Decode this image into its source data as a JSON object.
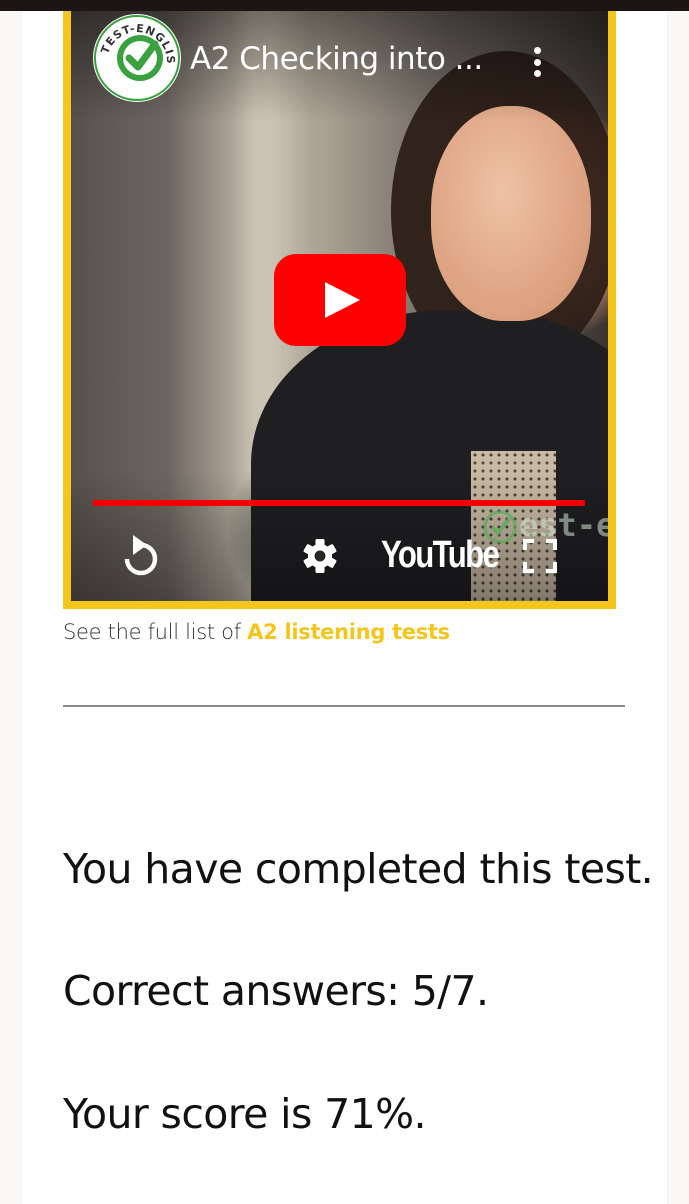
{
  "video": {
    "title": "A2 Checking into ...",
    "channel_logo_text": "TEST-ENGLISH",
    "brand": "YouTube",
    "watermark": "est-e",
    "progress": 1.0,
    "colors": {
      "frame": "#f4c51a",
      "progress": "#f20000",
      "play": "#ff0000",
      "logo_check": "#3aa13f"
    },
    "icons": [
      "more-vert-icon",
      "play-icon",
      "replay-icon",
      "settings-icon",
      "youtube-logo",
      "fullscreen-icon"
    ]
  },
  "caption": {
    "prefix": "See the full list of ",
    "link_text": "A2 listening tests"
  },
  "results": {
    "completed": "You have completed this test.",
    "correct": "Correct answers: 5/7.",
    "score": "Your score is 71%."
  }
}
